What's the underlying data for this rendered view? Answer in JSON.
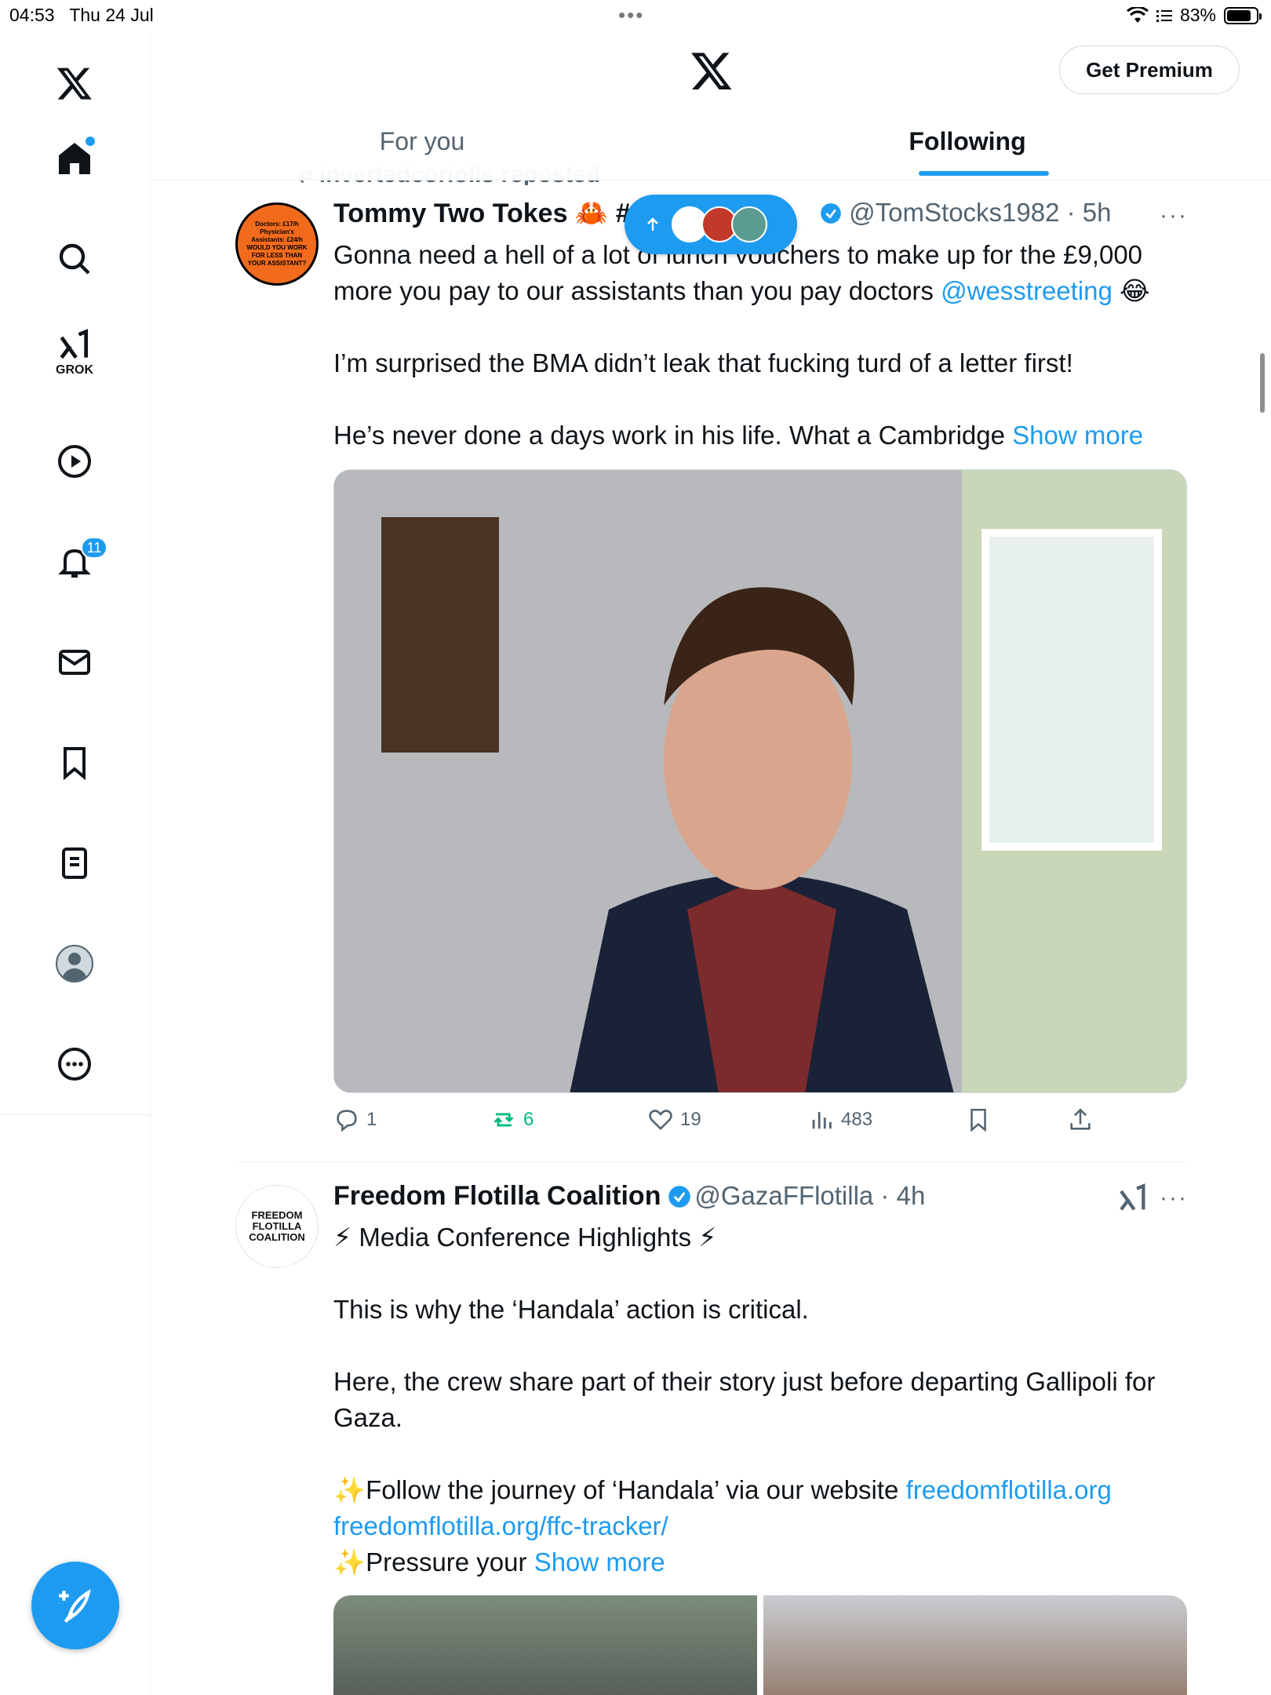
{
  "status_bar": {
    "time": "04:53",
    "date": "Thu 24 Jul",
    "battery": "83%"
  },
  "sidebar": {
    "items": [
      {
        "name": "home",
        "icon": "home-icon"
      },
      {
        "name": "search",
        "icon": "search-icon"
      },
      {
        "name": "grok",
        "icon": "grok-icon",
        "label": "GROK"
      },
      {
        "name": "video",
        "icon": "play-icon"
      },
      {
        "name": "notifications",
        "icon": "bell-icon",
        "badge": "11"
      },
      {
        "name": "messages",
        "icon": "mail-icon"
      },
      {
        "name": "bookmarks",
        "icon": "bookmark-icon"
      },
      {
        "name": "lists",
        "icon": "list-icon"
      },
      {
        "name": "profile",
        "icon": "avatar-icon"
      },
      {
        "name": "more",
        "icon": "more-circle-icon"
      }
    ]
  },
  "header": {
    "premium_label": "Get Premium",
    "tabs": [
      {
        "label": "For you"
      },
      {
        "label": "Following"
      }
    ]
  },
  "posts": [
    {
      "repost_text": "invertedcoriolis reposted",
      "avatar_text": "Doctors: £17/h Physician's Assistants: £24/h WOULD YOU WORK FOR LESS THAN YOUR ASSISTANT?",
      "name": "Tommy Two Tokes 🦀 #",
      "handle": "@TomStocks1982",
      "time": "5h",
      "text_line1": "Gonna need a hell of a lot of lunch vouchers to make up for the £9,000",
      "text_line2_pre": "more you pay to our assistants than you pay doctors ",
      "mention": "@wesstreeting",
      "emoji": "😂",
      "text_para2": "I’m surprised the BMA didn’t leak that fucking turd of a letter first!",
      "text_para3": "He’s never done a days work in his life. What a Cambridge ",
      "show_more": "Show more",
      "replies": "1",
      "reposts": "6",
      "likes": "19",
      "views": "483"
    },
    {
      "name": "Freedom Flotilla Coalition",
      "handle": "@GazaFFlotilla",
      "time": "4h",
      "avatar_text": "FREEDOM FLOTILLA COALITION",
      "line1_emoji_a": "⚡",
      "line1_text": "Media Conference Highlights",
      "line1_emoji_b": "⚡",
      "para2": "This is why the ‘Handala’ action is critical.",
      "para3": "Here, the crew share part of their story just before departing Gallipoli for Gaza.",
      "sparkle": "✨",
      "follow_text": "Follow the journey of ‘Handala’ via our website ",
      "link1": "freedomflotilla.org",
      "link2": "freedomflotilla.org/ffc-tracker/",
      "pressure_text": "Pressure your ",
      "show_more": "Show more"
    }
  ],
  "colors": {
    "accent": "#1d9bf0",
    "repost_green": "#00ba7c",
    "text": "#0f1419",
    "muted": "#536471"
  }
}
